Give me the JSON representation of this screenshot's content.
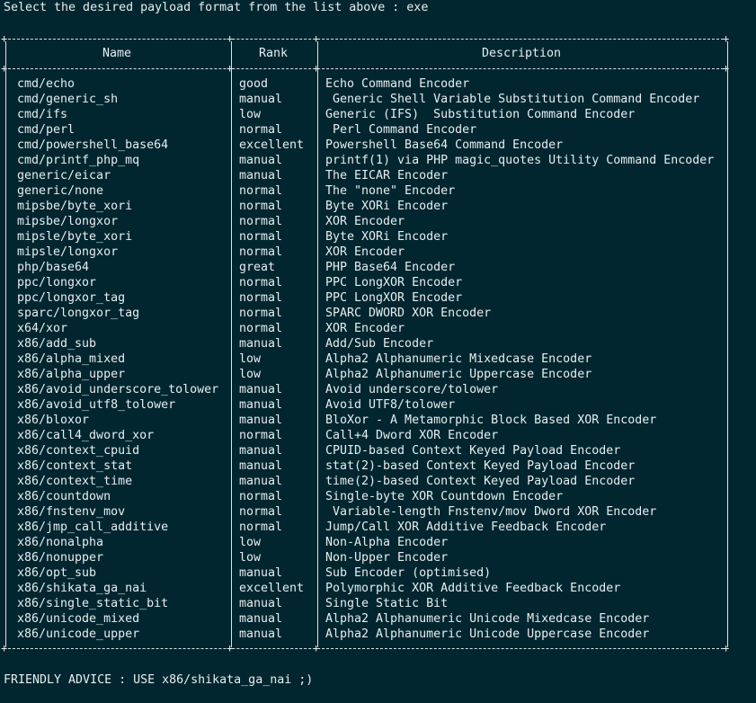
{
  "prompt_line": "Select the desired payload format from the list above : exe",
  "table": {
    "headers": {
      "name": "Name",
      "rank": "Rank",
      "description": "Description"
    },
    "rows": [
      {
        "name": "cmd/echo",
        "rank": "good",
        "description": "Echo Command Encoder"
      },
      {
        "name": "cmd/generic_sh",
        "rank": "manual",
        "description": " Generic Shell Variable Substitution Command Encoder"
      },
      {
        "name": "cmd/ifs",
        "rank": "low",
        "description": "Generic (IFS)  Substitution Command Encoder"
      },
      {
        "name": "cmd/perl",
        "rank": "normal",
        "description": " Perl Command Encoder"
      },
      {
        "name": "cmd/powershell_base64",
        "rank": "excellent",
        "description": "Powershell Base64 Command Encoder"
      },
      {
        "name": "cmd/printf_php_mq",
        "rank": "manual",
        "description": "printf(1) via PHP magic_quotes Utility Command Encoder"
      },
      {
        "name": "generic/eicar",
        "rank": "manual",
        "description": "The EICAR Encoder"
      },
      {
        "name": "generic/none",
        "rank": "normal",
        "description": "The \"none\" Encoder"
      },
      {
        "name": "mipsbe/byte_xori",
        "rank": "normal",
        "description": "Byte XORi Encoder"
      },
      {
        "name": "mipsbe/longxor",
        "rank": "normal",
        "description": "XOR Encoder"
      },
      {
        "name": "mipsle/byte_xori",
        "rank": "normal",
        "description": "Byte XORi Encoder"
      },
      {
        "name": "mipsle/longxor",
        "rank": "normal",
        "description": "XOR Encoder"
      },
      {
        "name": "php/base64",
        "rank": "great",
        "description": "PHP Base64 Encoder"
      },
      {
        "name": "ppc/longxor",
        "rank": "normal",
        "description": "PPC LongXOR Encoder"
      },
      {
        "name": "ppc/longxor_tag",
        "rank": "normal",
        "description": "PPC LongXOR Encoder"
      },
      {
        "name": "sparc/longxor_tag",
        "rank": "normal",
        "description": "SPARC DWORD XOR Encoder"
      },
      {
        "name": "x64/xor",
        "rank": "normal",
        "description": "XOR Encoder"
      },
      {
        "name": "x86/add_sub",
        "rank": "manual",
        "description": "Add/Sub Encoder"
      },
      {
        "name": "x86/alpha_mixed",
        "rank": "low",
        "description": "Alpha2 Alphanumeric Mixedcase Encoder"
      },
      {
        "name": "x86/alpha_upper",
        "rank": "low",
        "description": "Alpha2 Alphanumeric Uppercase Encoder"
      },
      {
        "name": "x86/avoid_underscore_tolower",
        "rank": "manual",
        "description": "Avoid underscore/tolower"
      },
      {
        "name": "x86/avoid_utf8_tolower",
        "rank": "manual",
        "description": "Avoid UTF8/tolower"
      },
      {
        "name": "x86/bloxor",
        "rank": "manual",
        "description": "BloXor - A Metamorphic Block Based XOR Encoder"
      },
      {
        "name": "x86/call4_dword_xor",
        "rank": "normal",
        "description": "Call+4 Dword XOR Encoder"
      },
      {
        "name": "x86/context_cpuid",
        "rank": "manual",
        "description": "CPUID-based Context Keyed Payload Encoder"
      },
      {
        "name": "x86/context_stat",
        "rank": "manual",
        "description": "stat(2)-based Context Keyed Payload Encoder"
      },
      {
        "name": "x86/context_time",
        "rank": "manual",
        "description": "time(2)-based Context Keyed Payload Encoder"
      },
      {
        "name": "x86/countdown",
        "rank": "normal",
        "description": "Single-byte XOR Countdown Encoder"
      },
      {
        "name": "x86/fnstenv_mov",
        "rank": "normal",
        "description": " Variable-length Fnstenv/mov Dword XOR Encoder"
      },
      {
        "name": "x86/jmp_call_additive",
        "rank": "normal",
        "description": "Jump/Call XOR Additive Feedback Encoder"
      },
      {
        "name": "x86/nonalpha",
        "rank": "low",
        "description": "Non-Alpha Encoder"
      },
      {
        "name": "x86/nonupper",
        "rank": "low",
        "description": "Non-Upper Encoder"
      },
      {
        "name": "x86/opt_sub",
        "rank": "manual",
        "description": "Sub Encoder (optimised)"
      },
      {
        "name": "x86/shikata_ga_nai",
        "rank": "excellent",
        "description": "Polymorphic XOR Additive Feedback Encoder"
      },
      {
        "name": "x86/single_static_bit",
        "rank": "manual",
        "description": "Single Static Bit"
      },
      {
        "name": "x86/unicode_mixed",
        "rank": "manual",
        "description": "Alpha2 Alphanumeric Unicode Mixedcase Encoder"
      },
      {
        "name": "x86/unicode_upper",
        "rank": "manual",
        "description": "Alpha2 Alphanumeric Unicode Uppercase Encoder"
      }
    ]
  },
  "advice_line": "FRIENDLY ADVICE : USE x86/shikata_ga_nai ;)",
  "colors": {
    "background": "#012630",
    "text": "#e6eef0"
  }
}
